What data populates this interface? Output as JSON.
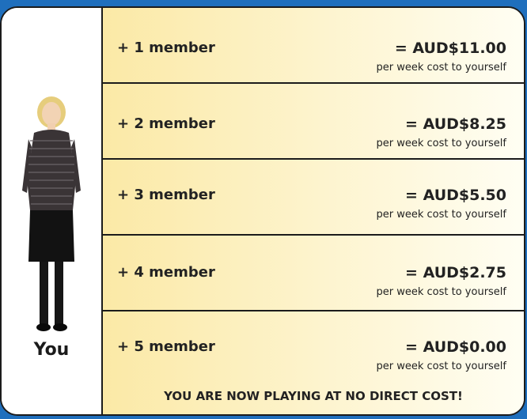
{
  "you_label": "You",
  "rows": [
    {
      "member": "+ 1 member",
      "price": "= AUD$11.00",
      "sub": "per week cost to yourself"
    },
    {
      "member": "+ 2 member",
      "price": "= AUD$8.25",
      "sub": "per week cost to yourself"
    },
    {
      "member": "+ 3 member",
      "price": "= AUD$5.50",
      "sub": "per week cost to yourself"
    },
    {
      "member": "+ 4 member",
      "price": "= AUD$2.75",
      "sub": "per week cost to yourself"
    },
    {
      "member": "+ 5 member",
      "price": "= AUD$0.00",
      "sub": "per week cost to yourself"
    }
  ],
  "final_message": "YOU ARE NOW PLAYING AT NO DIRECT COST!",
  "colors": {
    "frame_border": "#1b1b1b",
    "row_gradient_start": "#fbe9a6",
    "row_gradient_end": "#fffef3",
    "background_blue": "#1f6fbd"
  }
}
